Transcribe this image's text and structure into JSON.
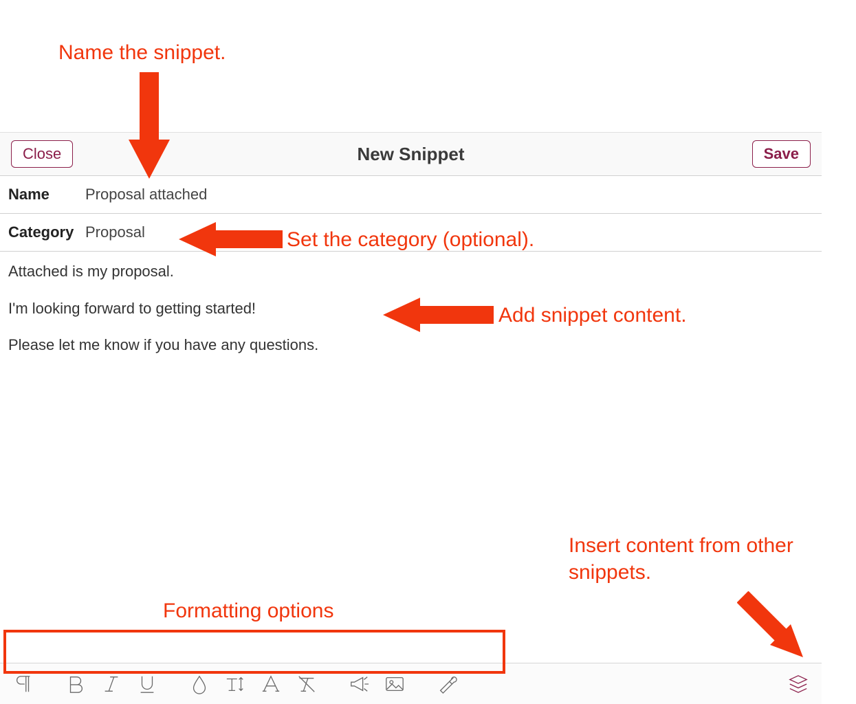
{
  "header": {
    "title": "New Snippet",
    "close_label": "Close",
    "save_label": "Save"
  },
  "fields": {
    "name_label": "Name",
    "name_value": "Proposal attached",
    "category_label": "Category",
    "category_value": "Proposal"
  },
  "content": {
    "line1": "Attached is my proposal.",
    "line2": "I'm looking forward to getting started!",
    "line3": "Please let me know if you have any questions."
  },
  "toolbar": {
    "paragraph": "paragraph-icon",
    "bold": "bold-icon",
    "italic": "italic-icon",
    "underline": "underline-icon",
    "color": "color-icon",
    "textsize": "text-size-icon",
    "font": "font-icon",
    "clear": "clear-format-icon",
    "announce": "megaphone-icon",
    "image": "image-icon",
    "tools": "tools-icon",
    "snippets": "stack-icon"
  },
  "annotations": {
    "a1": "Name the snippet.",
    "a2": "Set the category (optional).",
    "a3": "Add snippet content.",
    "a4": "Insert content from other snippets.",
    "a5": "Formatting options"
  }
}
